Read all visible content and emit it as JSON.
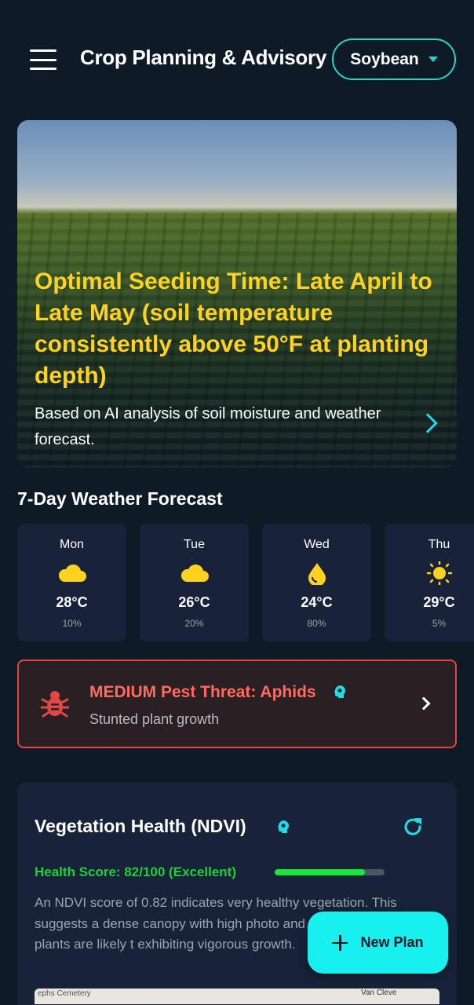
{
  "app_bar": {
    "title": "Crop Planning & Advisory",
    "crop_selector": "Soybean"
  },
  "hero": {
    "title": "Optimal Seeding Time: Late April to Late May (soil temperature consistently above 50°F at planting depth)",
    "subtitle": "Based on AI analysis of soil moisture and weather forecast."
  },
  "weather": {
    "section_title": "7-Day Weather Forecast",
    "days": [
      {
        "day": "Mon",
        "icon": "cloud-icon",
        "temp": "28°C",
        "rain": "10%"
      },
      {
        "day": "Tue",
        "icon": "cloud-icon",
        "temp": "26°C",
        "rain": "20%"
      },
      {
        "day": "Wed",
        "icon": "rain-drop-icon",
        "temp": "24°C",
        "rain": "80%"
      },
      {
        "day": "Thu",
        "icon": "sun-icon",
        "temp": "29°C",
        "rain": "5%"
      }
    ]
  },
  "pest_alert": {
    "title": "MEDIUM Pest Threat: Aphids",
    "subtitle": "Stunted plant growth"
  },
  "ndvi": {
    "title": "Vegetation Health (NDVI)",
    "score_label": "Health Score: 82/100 (Excellent)",
    "score_fraction": 0.82,
    "description": "An NDVI score of 0.82 indicates very healthy vegetation. This suggests a dense canopy with high photo and minimal stress. The plants are likely t exhibiting vigorous growth.",
    "map_label_left": "ephs Cemetery",
    "map_label_right": "Van Cleve"
  },
  "fab": {
    "label": "New Plan"
  },
  "colors": {
    "background": "#0f1a27",
    "accent": "#18f0f0",
    "hero_title": "#ffd21f",
    "pest_alert": "#ff6b62",
    "health_green": "#1ed13a"
  }
}
